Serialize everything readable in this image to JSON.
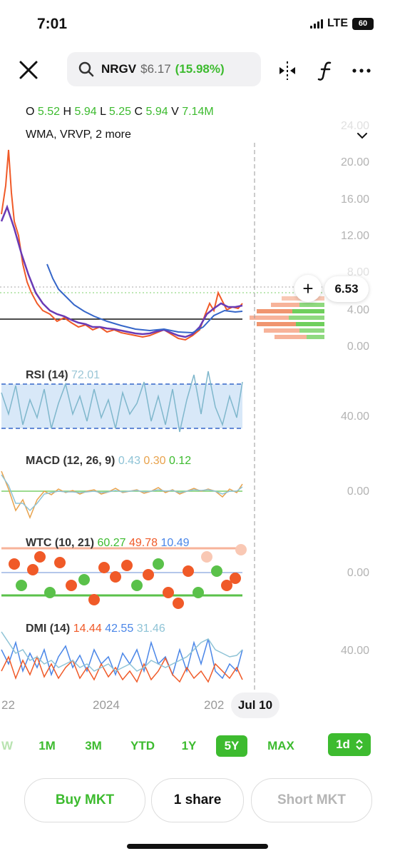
{
  "status": {
    "time": "7:01",
    "network": "LTE",
    "battery": "60"
  },
  "header": {
    "symbol": "NRGV",
    "price": "$6.17",
    "change": "(15.98%)",
    "icons": [
      "close-icon",
      "search-icon",
      "split-arrows-icon",
      "function-icon",
      "more-icon"
    ]
  },
  "ohlc": {
    "o_label": "O",
    "o": "5.52",
    "h_label": "H",
    "h": "5.94",
    "l_label": "L",
    "l": "5.25",
    "c_label": "C",
    "c": "5.94",
    "v_label": "V",
    "v": "7.14M"
  },
  "indicators_summary": "WMA, VRVP, 2 more",
  "price_axis": [
    "24.00",
    "20.00",
    "16.00",
    "12.00",
    "8.00",
    "4.00",
    "0.00"
  ],
  "current_price_tag": "6.53",
  "rsi": {
    "title": "RSI (14)",
    "value": "72.01",
    "axis": "40.00"
  },
  "macd": {
    "title": "MACD (12, 26, 9)",
    "v1": "0.43",
    "v2": "0.30",
    "v3": "0.12",
    "axis": "0.00"
  },
  "wtc": {
    "title": "WTC (10, 21)",
    "v1": "60.27",
    "v2": "49.78",
    "v3": "10.49",
    "axis": "0.00"
  },
  "dmi": {
    "title": "DMI (14)",
    "v1": "14.44",
    "v2": "42.55",
    "v3": "31.46",
    "axis": "40.00"
  },
  "dates": {
    "left": "22",
    "mid": "2024",
    "right": "202",
    "crosshair": "Jul 10"
  },
  "ranges": [
    "W",
    "1M",
    "3M",
    "YTD",
    "1Y",
    "5Y",
    "MAX"
  ],
  "active_range": "5Y",
  "interval": "1d",
  "actions": {
    "buy": "Buy MKT",
    "qty": "1 share",
    "short": "Short MKT"
  },
  "colors": {
    "green": "#3dbb2f",
    "orange": "#f05a28",
    "blue": "#4a86e8",
    "light_blue": "#8ec3d6",
    "purple": "#6a3bb5"
  }
}
